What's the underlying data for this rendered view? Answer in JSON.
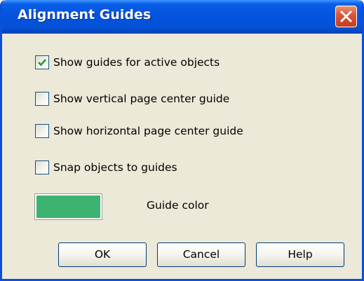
{
  "window": {
    "title": "Alignment Guides"
  },
  "options": [
    {
      "label": "Show guides for active objects",
      "checked": true
    },
    {
      "label": "Show vertical page center guide",
      "checked": false
    },
    {
      "label": "Show horizontal page center guide",
      "checked": false
    },
    {
      "label": "Snap objects to guides",
      "checked": false
    }
  ],
  "guide_color": {
    "label": "Guide color",
    "value": "#3cb371"
  },
  "buttons": {
    "ok": "OK",
    "cancel": "Cancel",
    "help": "Help"
  },
  "colors": {
    "titlebar": "#0451d8",
    "dialog_background": "#ece9d8",
    "close_button": "#d9573b"
  }
}
